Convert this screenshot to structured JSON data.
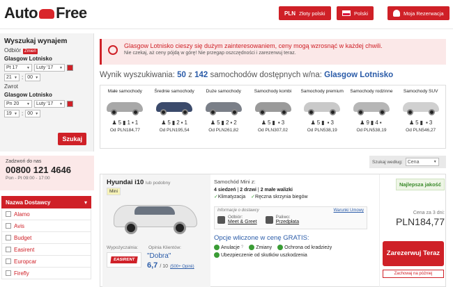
{
  "header": {
    "logo_left": "Auto",
    "logo_right": "Free",
    "currency_code": "PLN",
    "currency_name": "Złoty polski",
    "language": "Polski",
    "my_booking": "Moja Rezerwacja"
  },
  "search": {
    "title": "Wyszukaj wynajem",
    "pickup_label": "Odbiór",
    "change_badge": "Zmień",
    "pickup_location": "Glasgow Lotnisko",
    "pickup_day": "Pt 17",
    "pickup_month": "Luty '17",
    "pickup_hour": "21",
    "pickup_min": "00",
    "return_label": "Zwrot",
    "return_location": "Glasgow Lotnisko",
    "return_day": "Pn 20",
    "return_month": "Luty '17",
    "return_hour": "19",
    "return_min": "00",
    "search_button": "Szukaj"
  },
  "phone": {
    "label": "Zadzwoń do nas",
    "number": "00800 121 4646",
    "hours": "Pon - Pt 09:00 - 17:00"
  },
  "providers": {
    "title": "Nazwa Dostawcy",
    "items": [
      "Alamo",
      "Avis",
      "Budget",
      "Easirent",
      "Europcar",
      "Firefly"
    ]
  },
  "alert": {
    "line1": "Glasgow Lotnisko cieszy się dużym zainteresowaniem, ceny mogą wzrosnąć w każdej chwili.",
    "line2": "Nie czekaj, aż ceny pójdą w górę! Nie przegap oszczędności i zarezerwuj teraz."
  },
  "results": {
    "prefix": "Wynik wyszukiwania:",
    "count": "50",
    "of": "z",
    "total": "142",
    "suffix": "samochodów dostępnych w/na:",
    "location": "Glasgow Lotnisko"
  },
  "categories": [
    {
      "name": "Małe samochody",
      "seats": "5",
      "big": "1",
      "small": "1",
      "price": "Od PLN184,77",
      "color": "#a8a8a8"
    },
    {
      "name": "Średnie samochody",
      "seats": "5",
      "big": "2",
      "small": "1",
      "price": "Od PLN195,54",
      "color": "#3b4a6b"
    },
    {
      "name": "Duże samochody",
      "seats": "5",
      "big": "2",
      "small": "2",
      "price": "Od PLN261,82",
      "color": "#7a7f88"
    },
    {
      "name": "Samochody kombi",
      "seats": "5",
      "big": "",
      "small": "3",
      "price": "Od PLN307,02",
      "color": "#9a9a9a"
    },
    {
      "name": "Samochody premium",
      "seats": "5",
      "big": "",
      "small": "3",
      "price": "Od PLN538,19",
      "color": "#c9c9c9"
    },
    {
      "name": "Samochody rodzinne",
      "seats": "9",
      "big": "4",
      "small": "",
      "price": "Od PLN538,19",
      "color": "#b6b6b6"
    },
    {
      "name": "Samochody SUV",
      "seats": "5",
      "big": "",
      "small": "3",
      "price": "Od PLN546,27",
      "color": "#d0d0d0"
    }
  ],
  "sort": {
    "label": "Szukaj według:",
    "value": "Cena"
  },
  "car": {
    "name": "Hyundai i10",
    "similar": "lub podobny",
    "class_badge": "Mini",
    "supplier_label": "Wypożyczalnia:",
    "supplier_logo": "EASIRENT",
    "reviews_label": "Opinia Klientów:",
    "rating_word": "\"Dobra\"",
    "score": "6,7",
    "score_max": "/ 10",
    "reviews_link": "(500+ Opinii)",
    "type_line": "Samochód Mini z:",
    "spec_seats": "4 siedzeń",
    "spec_doors": "2 drzwi",
    "spec_bags": "2 małe walizki",
    "feature1": "Klimatyzacja",
    "feature2": "Ręczna skrzynia biegów",
    "provider_info": "Informacje o dostawcy",
    "terms_link": "Warunki Umowy",
    "pickup_key": "Odbiór:",
    "pickup_val": "Meet & Greet",
    "fuel_key": "Paliwo:",
    "fuel_val": "Przedpłata",
    "included_title": "Opcje wliczone w cenę GRATIS:",
    "inc1": "Anulacje",
    "inc2": "Zmiany",
    "inc3": "Ochrona od kradzieży",
    "inc4": "Ubezpieczenie od skutków uszkodzenia",
    "best_badge": "Najlepsza jakość",
    "price_label": "Cena za 3 dni:",
    "price": "PLN184,77",
    "book_button": "Zarezerwuj Teraz",
    "save_later": "Zachowaj na później"
  }
}
